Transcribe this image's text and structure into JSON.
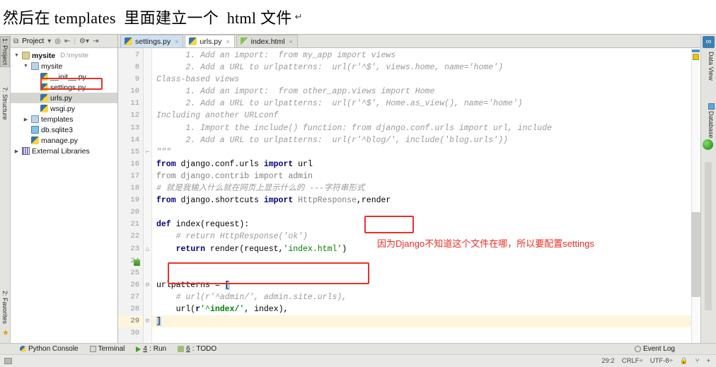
{
  "document_header": {
    "text": "然后在 templates  里面建立一个  html 文件",
    "mark": "↵"
  },
  "left_tool_tabs": [
    {
      "label": "1: Project",
      "selected": true
    },
    {
      "label": "7: Structure",
      "selected": false
    },
    {
      "label": "2: Favorites",
      "selected": false
    }
  ],
  "right_tool_tabs": [
    {
      "label": "Data View",
      "icon": "dataview-icon"
    },
    {
      "label": "Database",
      "icon": "database-icon"
    }
  ],
  "project_panel": {
    "title": "Project",
    "toolbar_icons": [
      "project-scope-icon",
      "collapse-icon",
      "target-icon",
      "settings-icon",
      "hide-icon"
    ],
    "tree": [
      {
        "depth": 0,
        "arrow": "▼",
        "icon": "folder",
        "label": "mysite",
        "bold": true,
        "path": "D:\\mysite",
        "selected": false
      },
      {
        "depth": 1,
        "arrow": "▼",
        "icon": "folder-blue",
        "label": "mysite",
        "bold": false,
        "path": "",
        "selected": false
      },
      {
        "depth": 2,
        "arrow": "",
        "icon": "py",
        "label": "__init__.py",
        "bold": false,
        "path": "",
        "selected": false
      },
      {
        "depth": 2,
        "arrow": "",
        "icon": "py",
        "label": "settings.py",
        "bold": false,
        "path": "",
        "selected": false
      },
      {
        "depth": 2,
        "arrow": "",
        "icon": "py",
        "label": "urls.py",
        "bold": false,
        "path": "",
        "selected": true
      },
      {
        "depth": 2,
        "arrow": "",
        "icon": "py",
        "label": "wsgi.py",
        "bold": false,
        "path": "",
        "selected": false
      },
      {
        "depth": 1,
        "arrow": "▶",
        "icon": "folder-blue",
        "label": "templates",
        "bold": false,
        "path": "",
        "selected": false
      },
      {
        "depth": 1,
        "arrow": "",
        "icon": "sqlite",
        "label": "db.sqlite3",
        "bold": false,
        "path": "",
        "selected": false
      },
      {
        "depth": 1,
        "arrow": "",
        "icon": "py",
        "label": "manage.py",
        "bold": false,
        "path": "",
        "selected": false
      },
      {
        "depth": 0,
        "arrow": "▶",
        "icon": "lib",
        "label": "External Libraries",
        "bold": false,
        "path": "",
        "selected": false
      }
    ]
  },
  "editor_tabs": [
    {
      "label": "settings.py",
      "icon": "py-file-icon",
      "active": false
    },
    {
      "label": "urls.py",
      "icon": "py-file-icon",
      "active": true
    },
    {
      "label": "index.html",
      "icon": "html-file-icon",
      "active": false
    }
  ],
  "editor": {
    "first_line": 7,
    "current_line": 29,
    "lines": [
      {
        "n": 7,
        "text": "      1. Add an import:  from my_app import views",
        "style": "comment"
      },
      {
        "n": 8,
        "text": "      2. Add a URL to urlpatterns:  url(r'^$', views.home, name='home')",
        "style": "comment"
      },
      {
        "n": 9,
        "text": "Class-based views",
        "style": "comment"
      },
      {
        "n": 10,
        "text": "      1. Add an import:  from other_app.views import Home",
        "style": "comment"
      },
      {
        "n": 11,
        "text": "      2. Add a URL to urlpatterns:  url(r'^$', Home.as_view(), name='home')",
        "style": "comment"
      },
      {
        "n": 12,
        "text": "Including another URLconf",
        "style": "comment"
      },
      {
        "n": 13,
        "text": "      1. Import the include() function: from django.conf.urls import url, include",
        "style": "comment"
      },
      {
        "n": 14,
        "text": "      2. Add a URL to urlpatterns:  url(r'^blog/', include('blog.urls'))",
        "style": "comment"
      },
      {
        "n": 15,
        "text": "\"\"\"",
        "style": "comment"
      },
      {
        "n": 16,
        "text": "from django.conf.urls import url",
        "style": "code-import-url"
      },
      {
        "n": 17,
        "text": "from django.contrib import admin",
        "style": "code-import-admin"
      },
      {
        "n": 18,
        "text": "# 就是我输入什么就在网页上显示什么的 ---字符串形式",
        "style": "comment"
      },
      {
        "n": 19,
        "text": "from django.shortcuts import HttpResponse,render",
        "style": "code-import-shortcuts"
      },
      {
        "n": 20,
        "text": "",
        "style": "blank"
      },
      {
        "n": 21,
        "text": "def index(request):",
        "style": "code-def"
      },
      {
        "n": 22,
        "text": "    # return HttpResponse('ok')",
        "style": "comment"
      },
      {
        "n": 23,
        "text": "    return render(request,'index.html')",
        "style": "code-return"
      },
      {
        "n": 24,
        "text": "",
        "style": "blank"
      },
      {
        "n": 25,
        "text": "",
        "style": "blank"
      },
      {
        "n": 26,
        "text": "urlpatterns = [",
        "style": "code-urlpatterns"
      },
      {
        "n": 27,
        "text": "    # url(r'^admin/', admin.site.urls),",
        "style": "comment"
      },
      {
        "n": 28,
        "text": "    url(r'^index/', index),",
        "style": "code-url-index"
      },
      {
        "n": 29,
        "text": "]",
        "style": "code-bracket-close"
      },
      {
        "n": 30,
        "text": "",
        "style": "blank"
      }
    ],
    "tokens": {
      "l16": [
        [
          "from ",
          "kw"
        ],
        [
          "django.conf.urls ",
          "plain"
        ],
        [
          "import ",
          "kw"
        ],
        [
          "url",
          "plain"
        ]
      ],
      "l17": [
        [
          "from ",
          "gray"
        ],
        [
          "django.contrib ",
          "gray"
        ],
        [
          "import ",
          "gray"
        ],
        [
          "admin",
          "gray"
        ]
      ],
      "l19": [
        [
          "from ",
          "kw"
        ],
        [
          "django.shortcuts ",
          "plain"
        ],
        [
          "import ",
          "kw"
        ],
        [
          "HttpResponse",
          "gray"
        ],
        [
          ",",
          "plain"
        ],
        [
          "render",
          "plain"
        ]
      ],
      "l21": [
        [
          "def ",
          "kw"
        ],
        [
          "index",
          "plain"
        ],
        [
          "(request):",
          "plain"
        ]
      ],
      "l23": [
        [
          "    ",
          "plain"
        ],
        [
          "return ",
          "kw"
        ],
        [
          "render(request,",
          "plain"
        ],
        [
          "'index.html'",
          "str"
        ],
        [
          ")",
          "plain"
        ]
      ],
      "l26": [
        [
          "urlpatterns = ",
          "plain"
        ],
        [
          "[",
          "sel"
        ]
      ],
      "l28": [
        [
          "    url(",
          "plain"
        ],
        [
          "r",
          "rx"
        ],
        [
          "'^",
          "str"
        ],
        [
          "index/",
          "greenb"
        ],
        [
          "'",
          "str"
        ],
        [
          ", index),",
          "plain"
        ]
      ],
      "l29": [
        [
          "]",
          "sel"
        ]
      ]
    }
  },
  "annotations": [
    {
      "id": "render-box",
      "type": "red-box",
      "note": "highlights render import"
    },
    {
      "id": "return-render-box",
      "type": "red-box",
      "note": "highlights return render line"
    },
    {
      "id": "urls-py-box",
      "type": "red-box",
      "note": "highlights urls.py in tree"
    },
    {
      "id": "settings-note",
      "type": "red-text",
      "text": "因为Django不知道这个文件在哪，所以要配置settings"
    }
  ],
  "bottom_bar": {
    "items": [
      {
        "label": "Python Console",
        "icon": "python-console-icon",
        "mnemonic": ""
      },
      {
        "label": "Terminal",
        "icon": "terminal-icon",
        "mnemonic": ""
      },
      {
        "label": "Run",
        "icon": "run-icon",
        "mnemonic": "4"
      },
      {
        "label": "TODO",
        "icon": "todo-icon",
        "mnemonic": "6"
      }
    ],
    "event_log": "Event Log"
  },
  "status_bar": {
    "caret": "29:2",
    "line_separator": "CRLF÷",
    "encoding": "UTF-8÷",
    "extra_icons": [
      "lock-icon",
      "branch-icon",
      "plus-icon"
    ]
  }
}
